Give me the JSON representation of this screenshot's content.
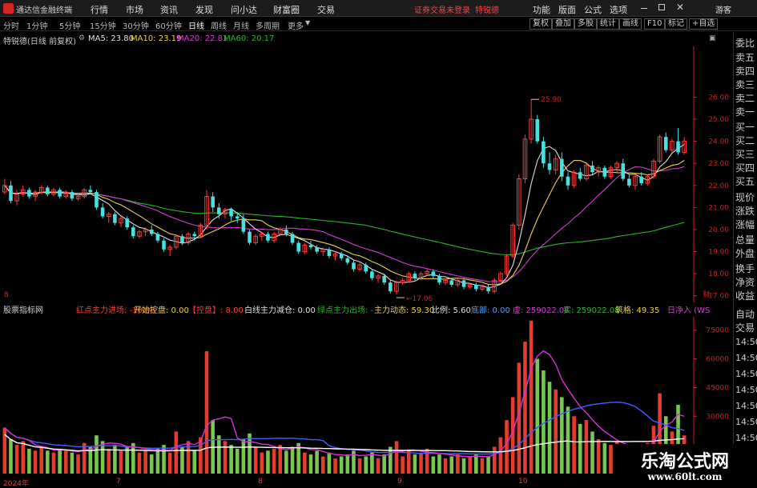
{
  "app": {
    "title": "通达信金融终端",
    "menu": [
      "行情",
      "市场",
      "资讯",
      "发现",
      "问小达",
      "财富圈",
      "交易"
    ],
    "notice": "证券交易未登录",
    "notice_stock": "特锐德",
    "right_menu": [
      "功能",
      "版面",
      "公式",
      "选项"
    ],
    "guest": "游客"
  },
  "tabs": [
    "分时",
    "1分钟",
    "5分钟",
    "15分钟",
    "30分钟",
    "60分钟",
    "日线",
    "周线",
    "月线",
    "多周期",
    "更多"
  ],
  "active_tab": "日线",
  "right_tabs": [
    "复权",
    "叠加",
    "多股",
    "统计",
    "画线",
    "F10",
    "标记",
    "+自选"
  ],
  "legend": {
    "name": "特锐德(日线 前复权)",
    "ma5": "MA5: 23.80",
    "ma10": "MA10: 23.19",
    "ma20": "MA20: 22.81",
    "ma60": "MA60: 20.17"
  },
  "colors": {
    "ma5": "#e0e0e0",
    "ma10": "#e8d24a",
    "ma20": "#d23fd2",
    "ma60": "#2ab52a",
    "up": "#ff3b3b",
    "down": "#48e0e0",
    "vol_up": "#e63c2f",
    "vol_down": "#78c850",
    "line1": "#d830d8",
    "line2": "#4060ff",
    "line3": "#ffffff"
  },
  "price_labels": [
    "26.00",
    "25.00",
    "24.00",
    "23.00",
    "22.00",
    "21.00",
    "20.00",
    "19.00",
    "18.00",
    "17.00"
  ],
  "annotations": {
    "high": "25.90",
    "low": "17.06",
    "mark_a": "8",
    "mark_b": "财"
  },
  "sub": {
    "name": "股票指标网",
    "items": [
      {
        "t": "红点主力进场: -10.08",
        "c": "#ff3b3b"
      },
      {
        "t": "开始控盘: 0.00",
        "c": "#e8d24a"
      },
      {
        "t": "【控盘】: 8.00",
        "c": "#ff3b3b"
      },
      {
        "t": "白线主力减仓: 0.00",
        "c": "#e0e0e0"
      },
      {
        "t": "绿点主力出场: -",
        "c": "#2ab52a"
      },
      {
        "t": "主力动态: 59.30",
        "c": "#e8d24a"
      },
      {
        "t": "比例: 5.60",
        "c": "#e0e0e0"
      },
      {
        "t": "底部: 0.00",
        "c": "#4aa0ff"
      },
      {
        "t": "虚: 259022.08",
        "c": "#d23fd2"
      },
      {
        "t": "实: 259022.08",
        "c": "#2ab52a"
      },
      {
        "t": "筑格: 49.35",
        "c": "#e8d24a"
      },
      {
        "t": "日净入 (WS",
        "c": "#d23fd2"
      }
    ]
  },
  "vol_labels": [
    "75000",
    "60000",
    "45000",
    "30000"
  ],
  "xaxis": [
    "2024年",
    "7",
    "8",
    "9",
    "10"
  ],
  "right_panel": [
    "委比",
    "卖五",
    "卖四",
    "卖三",
    "卖二",
    "卖一",
    "买一",
    "买二",
    "买三",
    "买四",
    "买五",
    "现价",
    "涨跌",
    "涨幅",
    "总量",
    "外盘",
    "换手",
    "净资",
    "收益",
    "自动",
    "交易",
    "14:50",
    "14:50",
    "14:50",
    "14:50",
    "14:50",
    "14:50",
    "14:50"
  ],
  "watermark": {
    "title": "乐淘公式网",
    "url": "www.60lt.com"
  },
  "chart_data": {
    "type": "candlestick",
    "ylim": [
      16.7,
      28.3
    ],
    "candles": [
      [
        21.7,
        22.3,
        21.6,
        22.0
      ],
      [
        22.0,
        22.2,
        21.2,
        21.3
      ],
      [
        21.3,
        21.8,
        21.1,
        21.6
      ],
      [
        21.6,
        22.0,
        21.5,
        21.8
      ],
      [
        21.8,
        21.9,
        21.4,
        21.5
      ],
      [
        21.5,
        21.8,
        21.3,
        21.7
      ],
      [
        21.7,
        22.0,
        21.6,
        21.9
      ],
      [
        21.9,
        22.0,
        21.5,
        21.6
      ],
      [
        21.6,
        21.9,
        21.5,
        21.8
      ],
      [
        21.8,
        21.9,
        21.4,
        21.5
      ],
      [
        21.5,
        21.8,
        21.4,
        21.7
      ],
      [
        21.7,
        21.8,
        21.3,
        21.4
      ],
      [
        21.4,
        21.6,
        21.3,
        21.5
      ],
      [
        21.5,
        21.9,
        21.4,
        21.8
      ],
      [
        21.8,
        22.0,
        21.6,
        21.7
      ],
      [
        21.7,
        21.8,
        20.9,
        21.0
      ],
      [
        21.0,
        21.2,
        20.5,
        20.6
      ],
      [
        20.6,
        20.8,
        20.3,
        20.7
      ],
      [
        20.7,
        20.8,
        20.2,
        20.3
      ],
      [
        20.3,
        20.6,
        20.1,
        20.5
      ],
      [
        20.5,
        20.6,
        20.0,
        20.1
      ],
      [
        20.1,
        20.2,
        19.6,
        19.7
      ],
      [
        19.7,
        20.0,
        19.6,
        19.9
      ],
      [
        19.9,
        20.1,
        19.7,
        20.0
      ],
      [
        20.0,
        20.2,
        19.7,
        19.8
      ],
      [
        19.8,
        19.9,
        19.4,
        19.5
      ],
      [
        19.5,
        19.6,
        19.0,
        19.1
      ],
      [
        19.1,
        19.3,
        18.8,
        19.2
      ],
      [
        19.2,
        19.8,
        19.1,
        19.7
      ],
      [
        19.7,
        19.8,
        19.3,
        19.4
      ],
      [
        19.4,
        19.9,
        19.3,
        19.8
      ],
      [
        19.8,
        19.9,
        19.5,
        19.7
      ],
      [
        19.7,
        20.3,
        19.6,
        20.2
      ],
      [
        20.2,
        21.8,
        20.0,
        21.5
      ],
      [
        21.5,
        21.7,
        20.8,
        21.0
      ],
      [
        21.0,
        21.2,
        20.5,
        20.7
      ],
      [
        20.7,
        21.0,
        20.5,
        20.9
      ],
      [
        20.9,
        21.0,
        20.4,
        20.6
      ],
      [
        20.6,
        20.8,
        20.3,
        20.5
      ],
      [
        20.5,
        20.7,
        19.8,
        19.9
      ],
      [
        19.9,
        20.0,
        19.3,
        19.4
      ],
      [
        19.4,
        19.8,
        19.3,
        19.7
      ],
      [
        19.7,
        19.9,
        19.5,
        19.8
      ],
      [
        19.8,
        19.9,
        19.4,
        19.5
      ],
      [
        19.5,
        19.9,
        19.4,
        19.8
      ],
      [
        19.8,
        20.1,
        19.7,
        20.0
      ],
      [
        20.0,
        20.2,
        19.7,
        19.8
      ],
      [
        19.8,
        19.9,
        19.3,
        19.4
      ],
      [
        19.4,
        19.5,
        18.9,
        19.0
      ],
      [
        19.0,
        19.4,
        18.9,
        19.3
      ],
      [
        19.3,
        19.5,
        19.1,
        19.2
      ],
      [
        19.2,
        19.3,
        18.9,
        19.0
      ],
      [
        19.0,
        19.2,
        18.8,
        19.1
      ],
      [
        19.1,
        19.2,
        18.7,
        18.8
      ],
      [
        18.8,
        19.0,
        18.6,
        18.9
      ],
      [
        18.9,
        19.0,
        18.6,
        18.7
      ],
      [
        18.7,
        18.8,
        18.4,
        18.5
      ],
      [
        18.5,
        18.6,
        18.1,
        18.2
      ],
      [
        18.2,
        18.5,
        18.1,
        18.4
      ],
      [
        18.4,
        18.5,
        18.0,
        18.1
      ],
      [
        18.1,
        18.2,
        17.7,
        17.8
      ],
      [
        17.8,
        18.0,
        17.6,
        17.9
      ],
      [
        17.9,
        18.0,
        17.5,
        17.6
      ],
      [
        17.6,
        17.7,
        17.1,
        17.2
      ],
      [
        17.2,
        17.7,
        17.06,
        17.6
      ],
      [
        17.6,
        17.8,
        17.5,
        17.7
      ],
      [
        17.7,
        18.1,
        17.6,
        18.0
      ],
      [
        18.0,
        18.1,
        17.7,
        17.8
      ],
      [
        17.8,
        18.1,
        17.7,
        18.0
      ],
      [
        18.0,
        18.2,
        17.9,
        18.1
      ],
      [
        18.1,
        18.2,
        17.8,
        17.9
      ],
      [
        17.9,
        18.0,
        17.5,
        17.6
      ],
      [
        17.6,
        17.8,
        17.5,
        17.7
      ],
      [
        17.7,
        17.8,
        17.4,
        17.5
      ],
      [
        17.5,
        17.8,
        17.4,
        17.7
      ],
      [
        17.7,
        17.8,
        17.3,
        17.4
      ],
      [
        17.4,
        17.6,
        17.3,
        17.5
      ],
      [
        17.5,
        17.6,
        17.2,
        17.3
      ],
      [
        17.3,
        17.5,
        17.2,
        17.4
      ],
      [
        17.4,
        17.5,
        17.1,
        17.2
      ],
      [
        17.2,
        17.8,
        17.1,
        17.7
      ],
      [
        17.7,
        18.1,
        17.6,
        18.0
      ],
      [
        18.0,
        18.9,
        17.9,
        18.8
      ],
      [
        18.8,
        20.3,
        18.7,
        20.2
      ],
      [
        20.2,
        22.5,
        20.0,
        22.3
      ],
      [
        22.3,
        24.3,
        22.1,
        24.1
      ],
      [
        24.1,
        25.9,
        23.9,
        25.0
      ],
      [
        25.0,
        25.2,
        23.9,
        24.0
      ],
      [
        24.0,
        24.2,
        22.8,
        23.0
      ],
      [
        23.0,
        23.5,
        22.5,
        22.7
      ],
      [
        22.7,
        23.4,
        22.5,
        23.2
      ],
      [
        23.2,
        23.5,
        22.2,
        22.4
      ],
      [
        22.4,
        22.6,
        21.8,
        22.0
      ],
      [
        22.0,
        22.7,
        21.9,
        22.6
      ],
      [
        22.6,
        22.8,
        22.2,
        22.3
      ],
      [
        22.3,
        23.0,
        22.2,
        22.9
      ],
      [
        22.9,
        23.1,
        22.5,
        22.6
      ],
      [
        22.6,
        22.9,
        22.4,
        22.8
      ],
      [
        22.8,
        22.9,
        22.3,
        22.4
      ],
      [
        22.4,
        22.9,
        22.3,
        22.8
      ],
      [
        22.8,
        23.1,
        22.6,
        23.0
      ],
      [
        23.0,
        23.2,
        22.2,
        22.3
      ],
      [
        22.3,
        22.5,
        21.9,
        22.0
      ],
      [
        22.0,
        22.5,
        21.8,
        22.4
      ],
      [
        22.4,
        22.6,
        22.0,
        22.1
      ],
      [
        22.1,
        22.5,
        22.0,
        22.4
      ],
      [
        22.4,
        23.2,
        22.3,
        23.1
      ],
      [
        23.1,
        24.3,
        23.0,
        24.2
      ],
      [
        24.2,
        24.4,
        23.5,
        23.6
      ],
      [
        23.6,
        24.1,
        23.5,
        24.0
      ],
      [
        24.0,
        24.6,
        23.4,
        23.5
      ],
      [
        23.5,
        24.2,
        23.4,
        24.0
      ]
    ],
    "volumes": [
      [
        24000,
        1
      ],
      [
        18000,
        0
      ],
      [
        15000,
        1
      ],
      [
        17000,
        1
      ],
      [
        13000,
        0
      ],
      [
        12000,
        1
      ],
      [
        14000,
        1
      ],
      [
        12000,
        0
      ],
      [
        11000,
        1
      ],
      [
        13000,
        0
      ],
      [
        12000,
        1
      ],
      [
        11000,
        0
      ],
      [
        10000,
        1
      ],
      [
        16000,
        1
      ],
      [
        14000,
        0
      ],
      [
        20000,
        0
      ],
      [
        17000,
        0
      ],
      [
        13000,
        1
      ],
      [
        15000,
        0
      ],
      [
        12000,
        1
      ],
      [
        14000,
        0
      ],
      [
        16000,
        0
      ],
      [
        11000,
        1
      ],
      [
        12000,
        1
      ],
      [
        10000,
        0
      ],
      [
        13000,
        0
      ],
      [
        15000,
        0
      ],
      [
        11000,
        1
      ],
      [
        22000,
        1
      ],
      [
        14000,
        0
      ],
      [
        17000,
        1
      ],
      [
        12000,
        0
      ],
      [
        19000,
        1
      ],
      [
        64000,
        1
      ],
      [
        28000,
        0
      ],
      [
        20000,
        0
      ],
      [
        17000,
        1
      ],
      [
        15000,
        0
      ],
      [
        13000,
        0
      ],
      [
        18000,
        0
      ],
      [
        21000,
        0
      ],
      [
        14000,
        1
      ],
      [
        11000,
        1
      ],
      [
        12000,
        0
      ],
      [
        13000,
        1
      ],
      [
        15000,
        1
      ],
      [
        12000,
        0
      ],
      [
        14000,
        0
      ],
      [
        16000,
        0
      ],
      [
        11000,
        1
      ],
      [
        10000,
        0
      ],
      [
        12000,
        0
      ],
      [
        9000,
        1
      ],
      [
        11000,
        0
      ],
      [
        8000,
        1
      ],
      [
        9000,
        0
      ],
      [
        10000,
        0
      ],
      [
        12000,
        0
      ],
      [
        8000,
        1
      ],
      [
        9000,
        0
      ],
      [
        11000,
        0
      ],
      [
        8000,
        1
      ],
      [
        10000,
        0
      ],
      [
        14000,
        0
      ],
      [
        17000,
        1
      ],
      [
        9000,
        1
      ],
      [
        12000,
        1
      ],
      [
        10000,
        0
      ],
      [
        11000,
        1
      ],
      [
        13000,
        1
      ],
      [
        9000,
        0
      ],
      [
        10000,
        0
      ],
      [
        8000,
        1
      ],
      [
        9000,
        0
      ],
      [
        10000,
        1
      ],
      [
        8000,
        0
      ],
      [
        9000,
        1
      ],
      [
        10000,
        0
      ],
      [
        8000,
        1
      ],
      [
        9000,
        0
      ],
      [
        14000,
        1
      ],
      [
        19000,
        1
      ],
      [
        28000,
        1
      ],
      [
        40000,
        1
      ],
      [
        58000,
        1
      ],
      [
        69000,
        1
      ],
      [
        80000,
        1
      ],
      [
        60000,
        0
      ],
      [
        54000,
        0
      ],
      [
        48000,
        0
      ],
      [
        44000,
        1
      ],
      [
        40000,
        0
      ],
      [
        35000,
        0
      ],
      [
        30000,
        1
      ],
      [
        26000,
        0
      ],
      [
        28000,
        1
      ],
      [
        22000,
        0
      ],
      [
        18000,
        1
      ],
      [
        16000,
        0
      ],
      [
        15000,
        1
      ],
      [
        17000,
        1
      ],
      [
        14000,
        0
      ],
      [
        12000,
        0
      ],
      [
        15000,
        1
      ],
      [
        13000,
        0
      ],
      [
        16000,
        1
      ],
      [
        25000,
        1
      ],
      [
        42000,
        1
      ],
      [
        30000,
        0
      ],
      [
        22000,
        1
      ],
      [
        36000,
        0
      ],
      [
        20000,
        1
      ]
    ]
  }
}
